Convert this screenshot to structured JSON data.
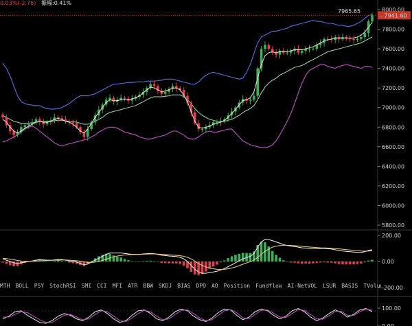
{
  "header": {
    "change_text": "0.03%(-2.76)",
    "amplitude_label": "振幅:",
    "amplitude_value": "0.41%"
  },
  "price_tags": {
    "high_marker": "7965.65",
    "last_price": "7941.60"
  },
  "indicator_tabs": [
    "MTH",
    "BOLL",
    "PSY",
    "StochRSI",
    "SMI",
    "CCI",
    "MFI",
    "ATR",
    "BBW",
    "SKDJ",
    "BIAS",
    "DPO",
    "AO",
    "Position",
    "Fundflow",
    "AI-NetVOL",
    "LSUR",
    "BASIS",
    "TVolume"
  ],
  "colors": {
    "up": "#3cae5c",
    "down": "#e0404e",
    "boll_upper": "#5a6fe0",
    "boll_lower": "#c454c8",
    "ma_fast": "#f0e8c8",
    "ma_slow": "#9fe0b4",
    "accent": "#c0392b"
  },
  "chart_data": [
    {
      "type": "candlestick",
      "name": "price",
      "ylim": [
        5800,
        8000
      ],
      "yticks": [
        "8000.00",
        "7800.00",
        "7600.00",
        "7400.00",
        "7200.00",
        "7000.00",
        "6800.00",
        "6600.00",
        "6400.00",
        "6200.00",
        "6000.00",
        "5800.00"
      ],
      "close": [
        6900,
        6820,
        6760,
        6720,
        6750,
        6800,
        6820,
        6830,
        6850,
        6880,
        6850,
        6830,
        6850,
        6870,
        6900,
        6890,
        6880,
        6860,
        6850,
        6840,
        6800,
        6750,
        6700,
        6780,
        6850,
        6920,
        6980,
        7030,
        7080,
        7100,
        7060,
        7080,
        7100,
        7090,
        7070,
        7090,
        7110,
        7130,
        7160,
        7200,
        7240,
        7220,
        7170,
        7140,
        7160,
        7190,
        7220,
        7200,
        7180,
        7120,
        7050,
        6950,
        6840,
        6780,
        6780,
        6800,
        6820,
        6850,
        6850,
        6860,
        6880,
        6920,
        6960,
        7000,
        7050,
        7090,
        7070,
        7080,
        7120,
        7400,
        7600,
        7640,
        7600,
        7560,
        7540,
        7580,
        7560,
        7560,
        7580,
        7600,
        7560,
        7580,
        7600,
        7600,
        7600,
        7640,
        7660,
        7700,
        7700,
        7690,
        7720,
        7700,
        7720,
        7710,
        7700,
        7690,
        7700,
        7720,
        7760,
        7880,
        7942
      ],
      "bb_upper": [
        7450,
        7400,
        7320,
        7220,
        7120,
        7060,
        7040,
        7030,
        7025,
        7020,
        7020,
        7000,
        6990,
        6985,
        6985,
        6990,
        7000,
        7020,
        7040,
        7070,
        7100,
        7120,
        7120,
        7120,
        7130,
        7140,
        7160,
        7180,
        7200,
        7220,
        7240,
        7240,
        7245,
        7250,
        7255,
        7255,
        7260,
        7265,
        7260,
        7270,
        7270,
        7270,
        7275,
        7280,
        7290,
        7290,
        7290,
        7280,
        7270,
        7260,
        7250,
        7240,
        7240,
        7260,
        7300,
        7330,
        7350,
        7360,
        7350,
        7340,
        7330,
        7320,
        7310,
        7300,
        7290,
        7300,
        7360,
        7440,
        7550,
        7660,
        7720,
        7740,
        7760,
        7780,
        7780,
        7790,
        7800,
        7810,
        7830,
        7840,
        7850,
        7860,
        7870,
        7880,
        7890,
        7880,
        7880,
        7870,
        7860,
        7860,
        7850,
        7840,
        7840,
        7830,
        7830,
        7840,
        7860,
        7880,
        7910,
        7940,
        7950
      ],
      "bb_lower": [
        6650,
        6660,
        6680,
        6700,
        6720,
        6750,
        6780,
        6800,
        6810,
        6790,
        6760,
        6730,
        6700,
        6670,
        6640,
        6620,
        6610,
        6620,
        6630,
        6640,
        6650,
        6660,
        6670,
        6680,
        6700,
        6720,
        6750,
        6770,
        6790,
        6800,
        6800,
        6790,
        6770,
        6750,
        6740,
        6730,
        6720,
        6700,
        6690,
        6680,
        6680,
        6690,
        6700,
        6710,
        6720,
        6740,
        6760,
        6760,
        6740,
        6720,
        6690,
        6680,
        6680,
        6700,
        6730,
        6750,
        6760,
        6750,
        6750,
        6760,
        6770,
        6780,
        6780,
        6740,
        6700,
        6660,
        6640,
        6620,
        6610,
        6600,
        6590,
        6590,
        6600,
        6620,
        6660,
        6720,
        6790,
        6860,
        6940,
        7040,
        7150,
        7250,
        7330,
        7380,
        7400,
        7420,
        7440,
        7440,
        7420,
        7410,
        7400,
        7420,
        7430,
        7440,
        7430,
        7420,
        7410,
        7400,
        7420,
        7420,
        7410
      ],
      "ma_fast": [
        6880,
        6850,
        6800,
        6760,
        6740,
        6760,
        6790,
        6810,
        6830,
        6850,
        6860,
        6850,
        6850,
        6860,
        6880,
        6890,
        6880,
        6860,
        6850,
        6830,
        6800,
        6760,
        6740,
        6780,
        6840,
        6900,
        6950,
        7000,
        7050,
        7080,
        7070,
        7070,
        7080,
        7080,
        7080,
        7090,
        7100,
        7120,
        7150,
        7180,
        7210,
        7200,
        7180,
        7160,
        7170,
        7180,
        7200,
        7200,
        7180,
        7130,
        7060,
        6960,
        6860,
        6800,
        6790,
        6800,
        6810,
        6830,
        6840,
        6850,
        6870,
        6900,
        6940,
        6980,
        7030,
        7070,
        7080,
        7100,
        7160,
        7300,
        7440,
        7530,
        7560,
        7570,
        7560,
        7570,
        7570,
        7570,
        7580,
        7590,
        7590,
        7590,
        7600,
        7610,
        7620,
        7640,
        7660,
        7680,
        7690,
        7700,
        7710,
        7710,
        7710,
        7710,
        7710,
        7710,
        7720,
        7740,
        7770,
        7820,
        7870
      ],
      "ma_slow": [
        6920,
        6900,
        6880,
        6860,
        6850,
        6840,
        6840,
        6840,
        6845,
        6850,
        6855,
        6860,
        6860,
        6860,
        6865,
        6870,
        6870,
        6865,
        6860,
        6855,
        6850,
        6840,
        6830,
        6830,
        6840,
        6860,
        6880,
        6900,
        6930,
        6950,
        6960,
        6970,
        6980,
        6990,
        7000,
        7010,
        7020,
        7040,
        7060,
        7080,
        7100,
        7110,
        7110,
        7110,
        7115,
        7120,
        7130,
        7130,
        7130,
        7110,
        7080,
        7040,
        6990,
        6950,
        6920,
        6900,
        6880,
        6870,
        6860,
        6860,
        6860,
        6870,
        6880,
        6900,
        6920,
        6950,
        6970,
        6990,
        7020,
        7080,
        7150,
        7210,
        7250,
        7280,
        7300,
        7330,
        7350,
        7370,
        7390,
        7410,
        7420,
        7430,
        7450,
        7470,
        7490,
        7510,
        7530,
        7550,
        7570,
        7580,
        7590,
        7600,
        7610,
        7620,
        7630,
        7640,
        7650,
        7660,
        7680,
        7700,
        7720
      ]
    },
    {
      "type": "macd",
      "name": "macd",
      "ylim": [
        -200,
        200
      ],
      "yticks": [
        "200.00",
        "0.00",
        "-200.00"
      ],
      "dif": [
        20,
        10,
        0,
        -10,
        -15,
        -10,
        -5,
        0,
        5,
        10,
        15,
        12,
        10,
        10,
        12,
        15,
        14,
        10,
        5,
        0,
        -5,
        -15,
        -25,
        -20,
        -5,
        10,
        25,
        40,
        55,
        65,
        65,
        65,
        65,
        62,
        58,
        55,
        55,
        55,
        58,
        60,
        62,
        60,
        55,
        48,
        45,
        42,
        40,
        38,
        32,
        20,
        0,
        -30,
        -60,
        -80,
        -90,
        -90,
        -85,
        -80,
        -75,
        -65,
        -55,
        -40,
        -25,
        -10,
        5,
        20,
        30,
        40,
        60,
        110,
        150,
        170,
        168,
        160,
        150,
        140,
        130,
        122,
        118,
        115,
        110,
        105,
        103,
        100,
        100,
        100,
        100,
        100,
        98,
        95,
        90,
        85,
        80,
        78,
        75,
        72,
        70,
        70,
        75,
        85,
        90
      ],
      "dea": [
        25,
        22,
        18,
        13,
        8,
        4,
        2,
        1,
        2,
        3,
        5,
        7,
        8,
        9,
        9,
        10,
        11,
        11,
        10,
        8,
        6,
        2,
        -3,
        -7,
        -8,
        -5,
        0,
        8,
        18,
        28,
        36,
        42,
        46,
        50,
        52,
        53,
        54,
        55,
        56,
        57,
        58,
        58,
        57,
        55,
        53,
        51,
        49,
        47,
        44,
        40,
        32,
        20,
        2,
        -15,
        -30,
        -42,
        -50,
        -56,
        -60,
        -61,
        -60,
        -56,
        -50,
        -42,
        -32,
        -21,
        -11,
        -1,
        11,
        31,
        55,
        78,
        96,
        110,
        118,
        122,
        124,
        124,
        123,
        121,
        119,
        116,
        113,
        111,
        109,
        107,
        105,
        104,
        103,
        101,
        99,
        97,
        94,
        91,
        88,
        85,
        82,
        80,
        79,
        80,
        82
      ]
    },
    {
      "type": "oscillator",
      "name": "sub_indicator",
      "ylim": [
        0,
        100
      ],
      "yticks": [
        "100.00",
        "0.00"
      ],
      "line_a": [
        40,
        55,
        80,
        85,
        60,
        40,
        20,
        15,
        30,
        55,
        70,
        60,
        40,
        30,
        50,
        80,
        90,
        70,
        40,
        20,
        30,
        60,
        85,
        90,
        70,
        40,
        30,
        50,
        80,
        95,
        85,
        55,
        35,
        25,
        45,
        75,
        95,
        90,
        60,
        35,
        50,
        80,
        95,
        85,
        60,
        40,
        55,
        85,
        98,
        80,
        50,
        30,
        45,
        70,
        90,
        75,
        50,
        65,
        90,
        98,
        80
      ],
      "line_b": [
        50,
        50,
        65,
        80,
        75,
        55,
        35,
        20,
        20,
        40,
        60,
        65,
        50,
        35,
        40,
        65,
        85,
        80,
        55,
        30,
        25,
        45,
        70,
        88,
        80,
        55,
        35,
        40,
        65,
        88,
        90,
        70,
        45,
        30,
        35,
        60,
        85,
        92,
        75,
        45,
        40,
        65,
        88,
        90,
        72,
        50,
        48,
        70,
        92,
        88,
        65,
        40,
        38,
        58,
        82,
        82,
        60,
        58,
        80,
        95,
        88
      ]
    }
  ]
}
